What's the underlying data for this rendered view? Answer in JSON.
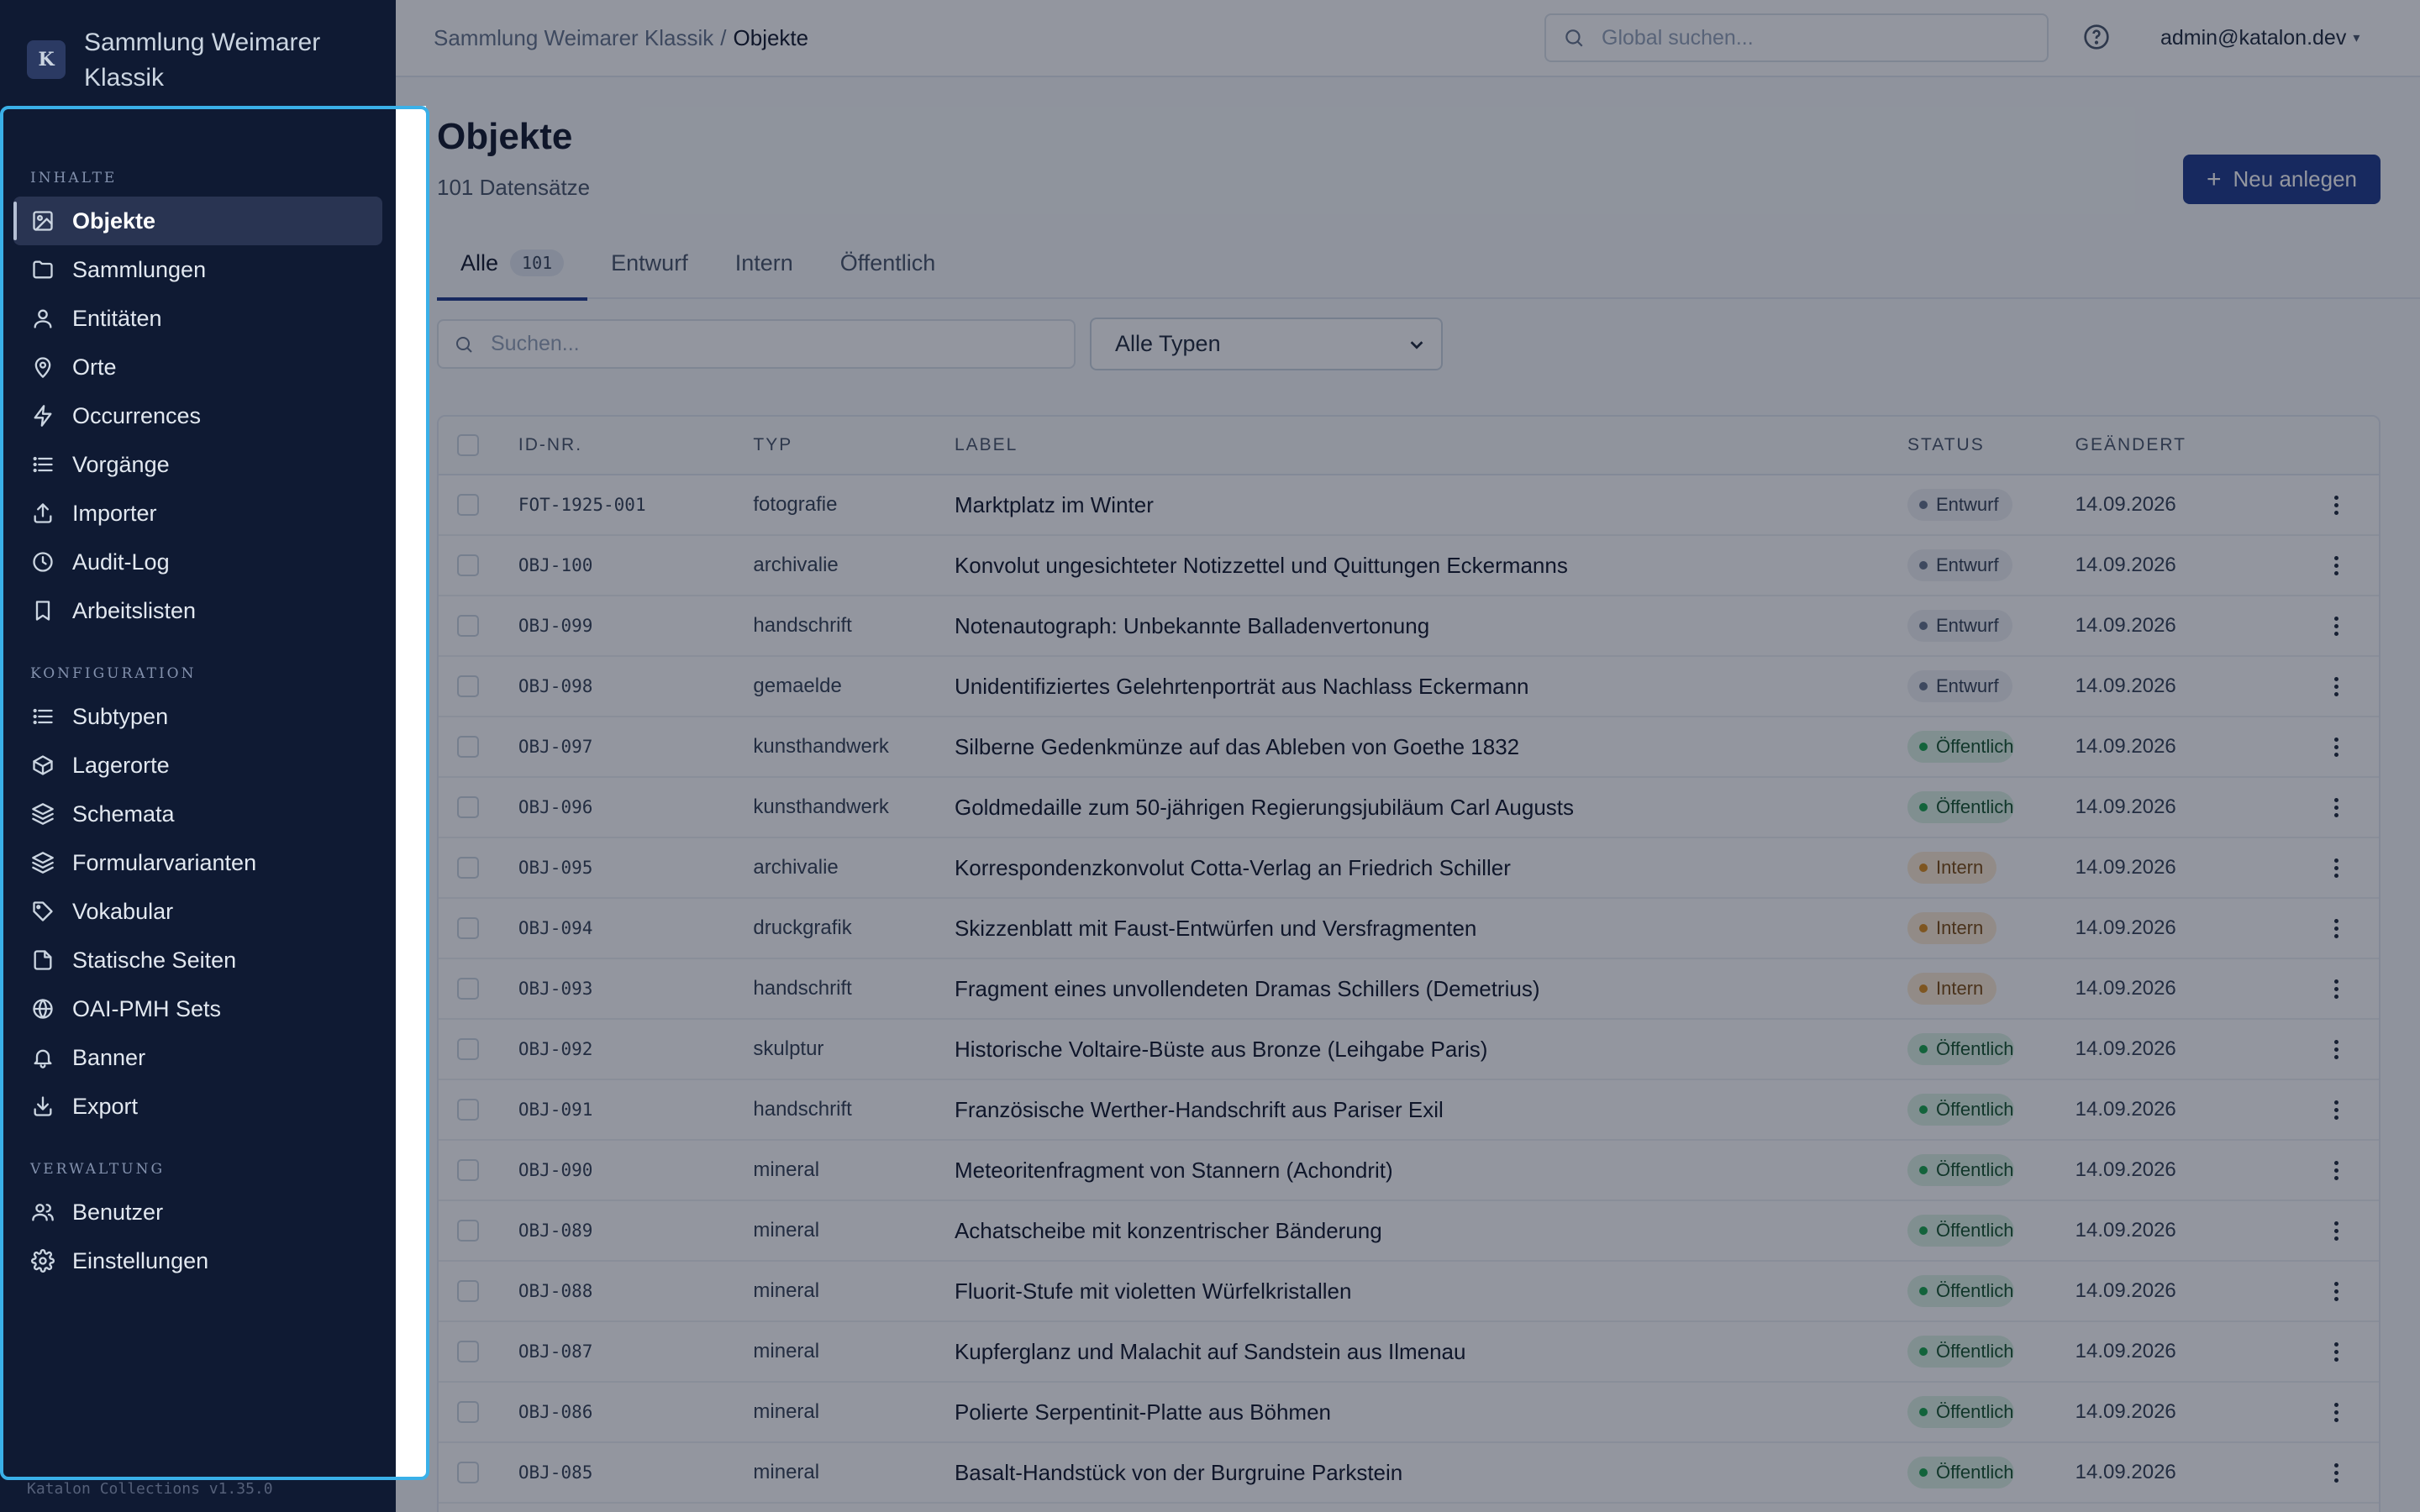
{
  "brand": {
    "logo_letter": "K",
    "name": "Sammlung Weimarer Klassik"
  },
  "sidebar": {
    "sections": [
      {
        "title": "INHALTE",
        "items": [
          {
            "label": "Objekte",
            "icon": "image-icon",
            "active": true
          },
          {
            "label": "Sammlungen",
            "icon": "folder-icon"
          },
          {
            "label": "Entitäten",
            "icon": "user-icon"
          },
          {
            "label": "Orte",
            "icon": "map-pin-icon"
          },
          {
            "label": "Occurrences",
            "icon": "lightning-icon"
          },
          {
            "label": "Vorgänge",
            "icon": "list-icon"
          },
          {
            "label": "Importer",
            "icon": "upload-icon"
          },
          {
            "label": "Audit-Log",
            "icon": "clock-icon"
          },
          {
            "label": "Arbeitslisten",
            "icon": "bookmark-icon"
          }
        ]
      },
      {
        "title": "KONFIGURATION",
        "items": [
          {
            "label": "Subtypen",
            "icon": "list-icon"
          },
          {
            "label": "Lagerorte",
            "icon": "box-icon"
          },
          {
            "label": "Schemata",
            "icon": "layers-icon"
          },
          {
            "label": "Formularvarianten",
            "icon": "layers-icon"
          },
          {
            "label": "Vokabular",
            "icon": "tag-icon"
          },
          {
            "label": "Statische Seiten",
            "icon": "file-icon"
          },
          {
            "label": "OAI-PMH Sets",
            "icon": "globe-icon"
          },
          {
            "label": "Banner",
            "icon": "bell-icon"
          },
          {
            "label": "Export",
            "icon": "download-icon"
          }
        ]
      },
      {
        "title": "VERWALTUNG",
        "items": [
          {
            "label": "Benutzer",
            "icon": "users-icon"
          },
          {
            "label": "Einstellungen",
            "icon": "gear-icon"
          }
        ]
      }
    ],
    "version": "Katalon Collections v1.35.0"
  },
  "topbar": {
    "breadcrumb_root": "Sammlung Weimarer Klassik",
    "breadcrumb_sep": "/",
    "breadcrumb_current": "Objekte",
    "search_placeholder": "Global suchen...",
    "user": "admin@katalon.dev"
  },
  "page": {
    "title": "Objekte",
    "subtitle": "101 Datensätze",
    "new_button": "Neu anlegen"
  },
  "tabs": [
    {
      "label": "Alle",
      "count": "101",
      "active": true
    },
    {
      "label": "Entwurf"
    },
    {
      "label": "Intern"
    },
    {
      "label": "Öffentlich"
    }
  ],
  "filters": {
    "search_placeholder": "Suchen...",
    "type_selected": "Alle Typen"
  },
  "table": {
    "headers": {
      "id": "ID-NR.",
      "typ": "TYP",
      "label": "LABEL",
      "status": "STATUS",
      "date": "GEÄNDERT"
    },
    "rows": [
      {
        "id": "FOT-1925-001",
        "typ": "fotografie",
        "label": "Marktplatz im Winter",
        "status": "Entwurf",
        "status_kind": "entwurf",
        "date": "14.09.2026"
      },
      {
        "id": "OBJ-100",
        "typ": "archivalie",
        "label": "Konvolut ungesichteter Notizzettel und Quittungen Eckermanns",
        "status": "Entwurf",
        "status_kind": "entwurf",
        "date": "14.09.2026"
      },
      {
        "id": "OBJ-099",
        "typ": "handschrift",
        "label": "Notenautograph: Unbekannte Balladenvertonung",
        "status": "Entwurf",
        "status_kind": "entwurf",
        "date": "14.09.2026"
      },
      {
        "id": "OBJ-098",
        "typ": "gemaelde",
        "label": "Unidentifiziertes Gelehrtenporträt aus Nachlass Eckermann",
        "status": "Entwurf",
        "status_kind": "entwurf",
        "date": "14.09.2026"
      },
      {
        "id": "OBJ-097",
        "typ": "kunsthandwerk",
        "label": "Silberne Gedenkmünze auf das Ableben von Goethe 1832",
        "status": "Öffentlich",
        "status_kind": "oeff",
        "date": "14.09.2026"
      },
      {
        "id": "OBJ-096",
        "typ": "kunsthandwerk",
        "label": "Goldmedaille zum 50-jährigen Regierungsjubiläum Carl Augusts",
        "status": "Öffentlich",
        "status_kind": "oeff",
        "date": "14.09.2026"
      },
      {
        "id": "OBJ-095",
        "typ": "archivalie",
        "label": "Korrespondenzkonvolut Cotta-Verlag an Friedrich Schiller",
        "status": "Intern",
        "status_kind": "intern",
        "date": "14.09.2026"
      },
      {
        "id": "OBJ-094",
        "typ": "druckgrafik",
        "label": "Skizzenblatt mit Faust-Entwürfen und Versfragmenten",
        "status": "Intern",
        "status_kind": "intern",
        "date": "14.09.2026"
      },
      {
        "id": "OBJ-093",
        "typ": "handschrift",
        "label": "Fragment eines unvollendeten Dramas Schillers (Demetrius)",
        "status": "Intern",
        "status_kind": "intern",
        "date": "14.09.2026"
      },
      {
        "id": "OBJ-092",
        "typ": "skulptur",
        "label": "Historische Voltaire-Büste aus Bronze (Leihgabe Paris)",
        "status": "Öffentlich",
        "status_kind": "oeff",
        "date": "14.09.2026"
      },
      {
        "id": "OBJ-091",
        "typ": "handschrift",
        "label": "Französische Werther-Handschrift aus Pariser Exil",
        "status": "Öffentlich",
        "status_kind": "oeff",
        "date": "14.09.2026"
      },
      {
        "id": "OBJ-090",
        "typ": "mineral",
        "label": "Meteoritenfragment von Stannern (Achondrit)",
        "status": "Öffentlich",
        "status_kind": "oeff",
        "date": "14.09.2026"
      },
      {
        "id": "OBJ-089",
        "typ": "mineral",
        "label": "Achatscheibe mit konzentrischer Bänderung",
        "status": "Öffentlich",
        "status_kind": "oeff",
        "date": "14.09.2026"
      },
      {
        "id": "OBJ-088",
        "typ": "mineral",
        "label": "Fluorit-Stufe mit violetten Würfelkristallen",
        "status": "Öffentlich",
        "status_kind": "oeff",
        "date": "14.09.2026"
      },
      {
        "id": "OBJ-087",
        "typ": "mineral",
        "label": "Kupferglanz und Malachit auf Sandstein aus Ilmenau",
        "status": "Öffentlich",
        "status_kind": "oeff",
        "date": "14.09.2026"
      },
      {
        "id": "OBJ-086",
        "typ": "mineral",
        "label": "Polierte Serpentinit-Platte aus Böhmen",
        "status": "Öffentlich",
        "status_kind": "oeff",
        "date": "14.09.2026"
      },
      {
        "id": "OBJ-085",
        "typ": "mineral",
        "label": "Basalt-Handstück von der Burgruine Parkstein",
        "status": "Öffentlich",
        "status_kind": "oeff",
        "date": "14.09.2026"
      }
    ]
  },
  "colors": {
    "sidebar_bg": "#0f1a33",
    "accent": "#1e3a8a",
    "focus_ring": "#3ab0e8",
    "status_entwurf": "#64748b",
    "status_intern": "#d98a1a",
    "status_oeffentlich": "#16a34a"
  }
}
